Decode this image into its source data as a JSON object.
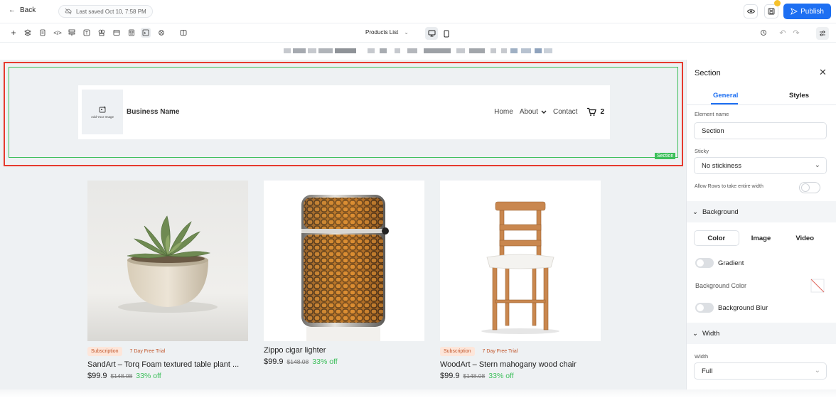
{
  "topbar": {
    "back_label": "Back",
    "saved_label": "Last saved Oct 10, 7:58 PM",
    "publish_label": "Publish"
  },
  "toolbar": {
    "page_select": "Products List",
    "icons": [
      "add-icon",
      "layers-icon",
      "pages-icon",
      "code-icon",
      "forms-icon",
      "text-icon",
      "media-icon",
      "layout-icon",
      "templates-icon",
      "components-icon",
      "global-icon",
      "split-view-icon"
    ]
  },
  "canvas": {
    "section_tag": "Section",
    "header": {
      "image_placeholder": "Add Your Image",
      "business_name": "Business Name",
      "nav": [
        "Home",
        "About",
        "Contact"
      ],
      "cart_count": "2"
    },
    "products": [
      {
        "tags": [
          "Subscription",
          "7 Day Free Trial"
        ],
        "name": "SandArt – Torq Foam textured table plant ...",
        "price": "$99.9",
        "old_price": "$148.08",
        "discount": "33% off"
      },
      {
        "tags": [],
        "name": "Zippo cigar lighter",
        "price": "$99.9",
        "old_price": "$148.08",
        "discount": "33% off"
      },
      {
        "tags": [
          "Subscription",
          "7 Day Free Trial"
        ],
        "name": "WoodArt – Stern mahogany wood chair",
        "price": "$99.9",
        "old_price": "$148.08",
        "discount": "33% off"
      }
    ]
  },
  "panel": {
    "title": "Section",
    "tabs": [
      "General",
      "Styles"
    ],
    "element_name_label": "Element name",
    "element_name_value": "Section",
    "sticky_label": "Sticky",
    "sticky_value": "No stickiness",
    "allow_rows_label": "Allow Rows to take entire width",
    "background_heading": "Background",
    "bg_tabs": [
      "Color",
      "Image",
      "Video"
    ],
    "gradient_label": "Gradient",
    "bg_color_label": "Background Color",
    "bg_blur_label": "Background Blur",
    "width_heading": "Width",
    "width_label": "Width",
    "width_value": "Full"
  },
  "colors": {
    "accent": "#1d6ff2",
    "selection_red": "#e63a2e",
    "selection_green": "#3cbf5a",
    "discount_green": "#3cbf5a",
    "tag_bg": "#fde6da",
    "tag_text": "#c1552a"
  }
}
